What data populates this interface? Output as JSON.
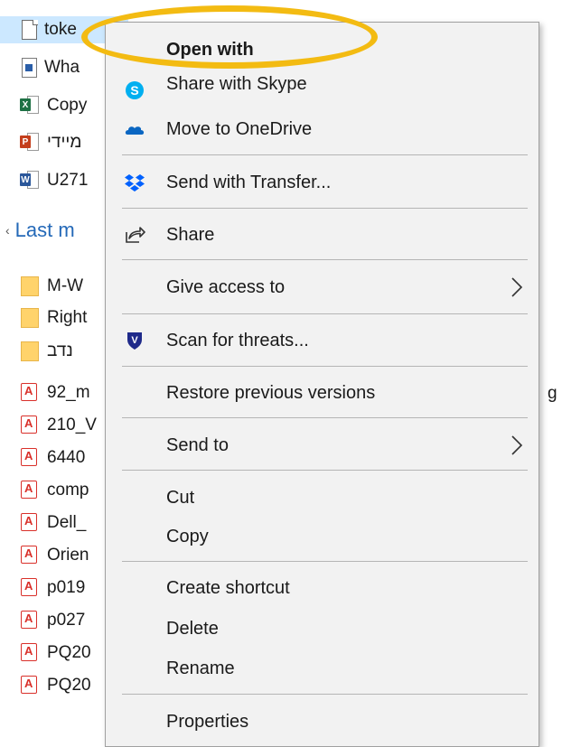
{
  "files_top": [
    {
      "name": "toke",
      "icon": "text-file-icon",
      "selected": true
    },
    {
      "name": "Wha",
      "icon": "image-file-icon"
    },
    {
      "name": "Copy",
      "icon": "excel-file-icon"
    },
    {
      "name": "מיידי",
      "icon": "powerpoint-file-icon"
    },
    {
      "name": "U271",
      "icon": "word-file-icon"
    }
  ],
  "section_title": "Last m",
  "files_bottom": [
    {
      "name": "M-W",
      "icon": "folder-icon"
    },
    {
      "name": "Right",
      "icon": "folder-icon"
    },
    {
      "name": "נדב",
      "icon": "folder-icon"
    },
    {
      "name": "92_m",
      "icon": "pdf-file-icon"
    },
    {
      "name": "210_V",
      "icon": "pdf-file-icon"
    },
    {
      "name": "6440",
      "icon": "pdf-file-icon"
    },
    {
      "name": "comp",
      "icon": "pdf-file-icon"
    },
    {
      "name": "Dell_",
      "icon": "pdf-file-icon"
    },
    {
      "name": "Orien",
      "icon": "pdf-file-icon"
    },
    {
      "name": "p019",
      "icon": "pdf-file-icon"
    },
    {
      "name": "p027",
      "icon": "pdf-file-icon"
    },
    {
      "name": "PQ20",
      "icon": "pdf-file-icon"
    },
    {
      "name": "PQ20",
      "icon": "pdf-file-icon"
    }
  ],
  "overflow_char": "g",
  "menu": {
    "open_with": "Open with",
    "share_skype": "Share with Skype",
    "move_onedrive": "Move to OneDrive",
    "send_transfer": "Send with Transfer...",
    "share": "Share",
    "give_access": "Give access to",
    "scan_threats": "Scan for threats...",
    "restore_versions": "Restore previous versions",
    "send_to": "Send to",
    "cut": "Cut",
    "copy": "Copy",
    "create_shortcut": "Create shortcut",
    "delete": "Delete",
    "rename": "Rename",
    "properties": "Properties"
  },
  "colors": {
    "highlight": "#f3bb12",
    "selection": "#cce8ff",
    "section_title": "#2469b8",
    "menu_bg": "#f2f2f2",
    "skype": "#00aff0",
    "onedrive": "#0a66c2",
    "dropbox": "#0061fe"
  }
}
